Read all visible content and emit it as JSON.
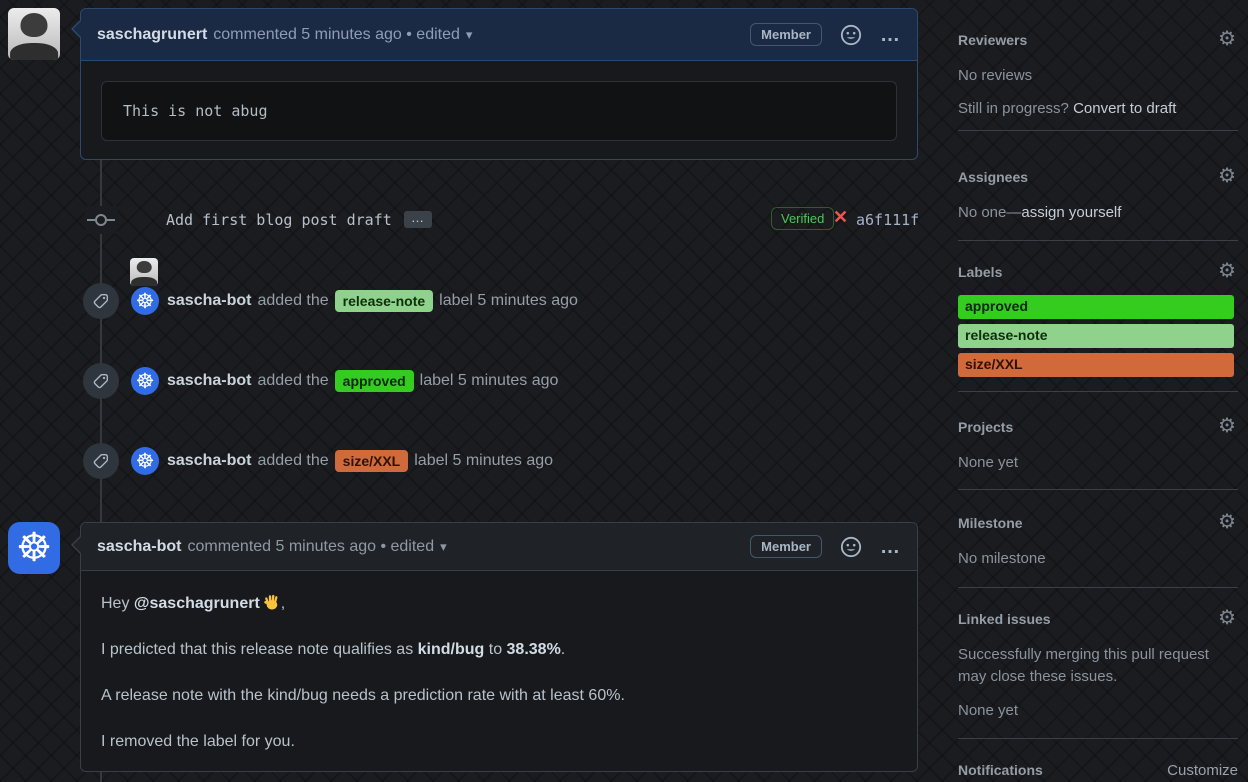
{
  "icons": {
    "gear": "⚙",
    "kebab": "…",
    "caret": "▾",
    "wheel": "☸",
    "x": "✕",
    "commit_ellipsis": "…"
  },
  "comment1": {
    "author": "saschagrunert",
    "meta": "commented 5 minutes ago • edited",
    "member_badge": "Member",
    "code": "This is not abug"
  },
  "commit": {
    "message": "Add first blog post draft",
    "verified": "Verified",
    "hash": "a6f111f"
  },
  "events": [
    {
      "user": "sascha-bot",
      "pre": "added the",
      "label": "release-note",
      "post": "label 5 minutes ago",
      "label_bg": "#8ed28b",
      "label_fg": "#0f2e0c"
    },
    {
      "user": "sascha-bot",
      "pre": "added the",
      "label": "approved",
      "post": "label 5 minutes ago",
      "label_bg": "#33cc1f",
      "label_fg": "#07280a"
    },
    {
      "user": "sascha-bot",
      "pre": "added the",
      "label": "size/XXL",
      "post": "label 5 minutes ago",
      "label_bg": "#d06a3b",
      "label_fg": "#2e1205"
    }
  ],
  "comment2": {
    "author": "sascha-bot",
    "meta": "commented 5 minutes ago • edited",
    "member_badge": "Member",
    "p1_pre": "Hey ",
    "p1_mention": "@saschagrunert",
    "p1_post": ",",
    "p2_pre": "I predicted that this release note qualifies as ",
    "p2_bold1": "kind/bug",
    "p2_mid": " to ",
    "p2_bold2": "38.38%",
    "p2_post": ".",
    "p3": "A release note with the kind/bug needs a prediction rate with at least 60%.",
    "p4": "I removed the label for you."
  },
  "sidebar": {
    "reviewers": {
      "title": "Reviewers",
      "empty": "No reviews",
      "hint_pre": "Still in progress? ",
      "hint_link": "Convert to draft"
    },
    "assignees": {
      "title": "Assignees",
      "empty_pre": "No one—",
      "empty_link": "assign yourself"
    },
    "labels": {
      "title": "Labels",
      "items": [
        {
          "text": "approved",
          "bg": "#33cc1f",
          "fg": "#07280a"
        },
        {
          "text": "release-note",
          "bg": "#8ed28b",
          "fg": "#0f2e0c"
        },
        {
          "text": "size/XXL",
          "bg": "#d06a3b",
          "fg": "#2e1205"
        }
      ]
    },
    "projects": {
      "title": "Projects",
      "empty": "None yet"
    },
    "milestone": {
      "title": "Milestone",
      "empty": "No milestone"
    },
    "linked_issues": {
      "title": "Linked issues",
      "desc": "Successfully merging this pull request may close these issues.",
      "empty": "None yet"
    },
    "notifications": {
      "title": "Notifications",
      "action": "Customize"
    }
  }
}
